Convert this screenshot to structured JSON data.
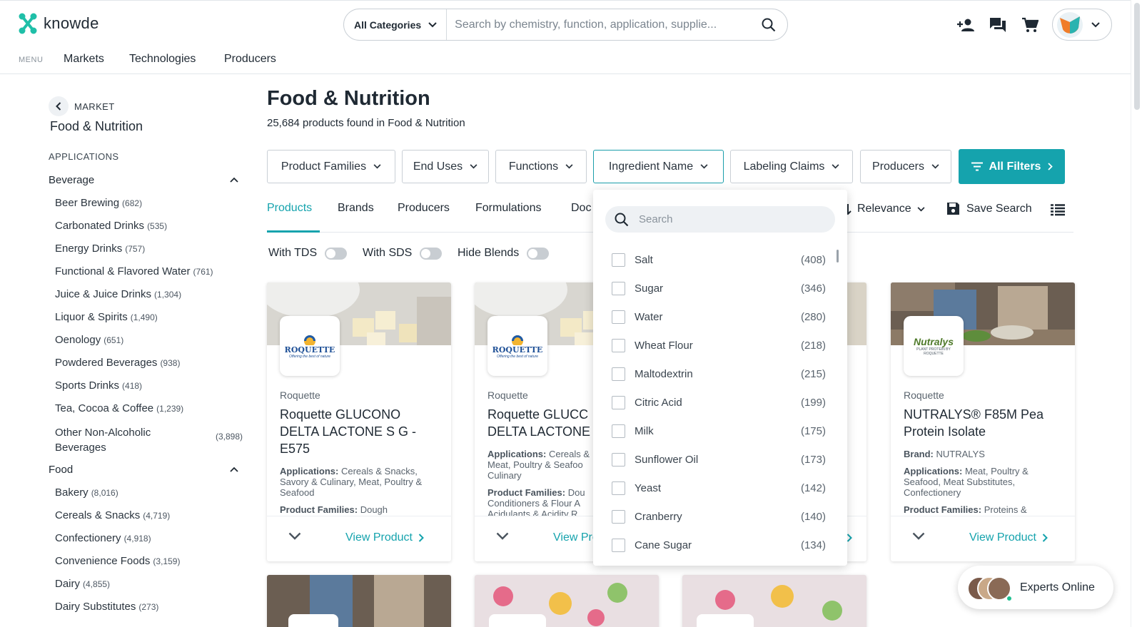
{
  "header": {
    "logo_text": "knowde",
    "category_select": "All Categories",
    "search_placeholder": "Search by chemistry, function, application, supplie...",
    "icons": [
      "add-user-icon",
      "chat-icon",
      "cart-icon"
    ],
    "menu_label": "MENU",
    "nav": [
      "Markets",
      "Technologies",
      "Producers"
    ]
  },
  "sidebar": {
    "market_label": "MARKET",
    "market_name": "Food & Nutrition",
    "applications_label": "APPLICATIONS",
    "groups": [
      {
        "name": "Beverage",
        "items": [
          {
            "label": "Beer Brewing",
            "count": "(682)"
          },
          {
            "label": "Carbonated Drinks",
            "count": "(535)"
          },
          {
            "label": "Energy Drinks",
            "count": "(757)"
          },
          {
            "label": "Functional & Flavored Water",
            "count": "(761)"
          },
          {
            "label": "Juice & Juice Drinks",
            "count": "(1,304)"
          },
          {
            "label": "Liquor & Spirits",
            "count": "(1,490)"
          },
          {
            "label": "Oenology",
            "count": "(651)"
          },
          {
            "label": "Powdered Beverages",
            "count": "(938)"
          },
          {
            "label": "Sports Drinks",
            "count": "(418)"
          },
          {
            "label": "Tea, Cocoa & Coffee",
            "count": "(1,239)"
          },
          {
            "label": "Other Non-Alcoholic Beverages",
            "count": "(3,898)"
          }
        ]
      },
      {
        "name": "Food",
        "items": [
          {
            "label": "Bakery",
            "count": "(8,016)"
          },
          {
            "label": "Cereals & Snacks",
            "count": "(4,719)"
          },
          {
            "label": "Confectionery",
            "count": "(4,918)"
          },
          {
            "label": "Convenience Foods",
            "count": "(3,159)"
          },
          {
            "label": "Dairy",
            "count": "(4,855)"
          },
          {
            "label": "Dairy Substitutes",
            "count": "(273)"
          }
        ]
      }
    ]
  },
  "main": {
    "title": "Food & Nutrition",
    "count_text": "25,684 products found in Food & Nutrition",
    "filters": [
      "Product Families",
      "End Uses",
      "Functions",
      "Ingredient Name",
      "Labeling Claims",
      "Producers"
    ],
    "all_filters": "All Filters",
    "tabs": [
      "Products",
      "Brands",
      "Producers",
      "Formulations",
      "Doc"
    ],
    "sort_label": "Relevance",
    "save_search": "Save Search",
    "toggles": [
      "With TDS",
      "With SDS",
      "Hide Blends"
    ],
    "view_product": "View Product",
    "cards": [
      {
        "brand": "Roquette",
        "logo": "ROQUETTE",
        "tagline": "Offering the best of nature",
        "title": "Roquette GLUCONO DELTA LACTONE S G - E575",
        "meta1_label": "Applications:",
        "meta1": "Cereals & Snacks, Savory & Culinary, Meat, Poultry & Seafood",
        "meta2_label": "Product Families:",
        "meta2": "Dough"
      },
      {
        "brand": "Roquette",
        "logo": "ROQUETTE",
        "tagline": "Offering the best of nature",
        "title": "Roquette GLUCC DELTA LACTONE",
        "meta1_label": "Applications:",
        "meta1": "Cereals & Meat, Poultry & Seafoo Culinary",
        "meta2_label": "Product Families:",
        "meta2": "Dou Conditioners & Flour A Acidulants & Acidity R"
      },
      {
        "brand": "Roquette",
        "logo": "Nutralys",
        "tagline": "PLANT PROTEIN BY ROQUETTE",
        "title": "NUTRALYS® F85M Pea Protein Isolate",
        "brand_line_label": "Brand:",
        "brand_line": "NUTRALYS",
        "meta1_label": "Applications:",
        "meta1": "Meat, Poultry & Seafood, Meat Substitutes, Confectionery",
        "meta2_label": "Product Families:",
        "meta2": "Proteins &"
      }
    ]
  },
  "dropdown": {
    "search_placeholder": "Search",
    "items": [
      {
        "label": "Salt",
        "count": "(408)"
      },
      {
        "label": "Sugar",
        "count": "(346)"
      },
      {
        "label": "Water",
        "count": "(280)"
      },
      {
        "label": "Wheat Flour",
        "count": "(218)"
      },
      {
        "label": "Maltodextrin",
        "count": "(215)"
      },
      {
        "label": "Citric Acid",
        "count": "(199)"
      },
      {
        "label": "Milk",
        "count": "(175)"
      },
      {
        "label": "Sunflower Oil",
        "count": "(173)"
      },
      {
        "label": "Yeast",
        "count": "(142)"
      },
      {
        "label": "Cranberry",
        "count": "(140)"
      },
      {
        "label": "Cane Sugar",
        "count": "(134)"
      }
    ]
  },
  "experts": {
    "label": "Experts Online"
  },
  "colors": {
    "accent": "#15a3ad",
    "text": "#1f2933",
    "online": "#1fbf8f"
  }
}
